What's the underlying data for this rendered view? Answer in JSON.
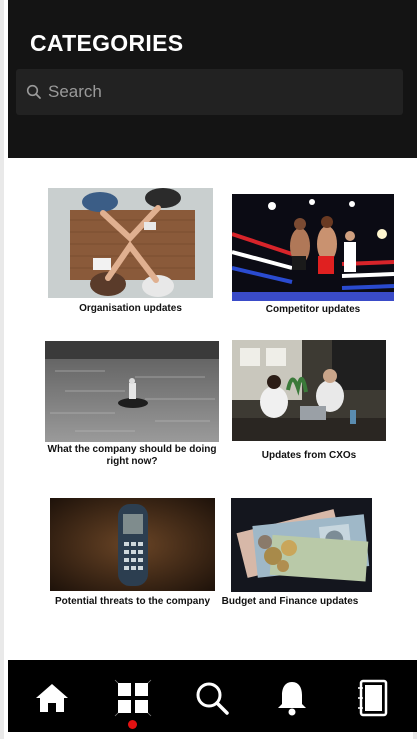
{
  "header": {
    "title": "CATEGORIES",
    "search_placeholder": "Search"
  },
  "categories": [
    {
      "label": "Organisation updates",
      "icon": "teamwork-hands-photo"
    },
    {
      "label": "Competitor updates",
      "icon": "boxing-ring-photo"
    },
    {
      "label": "What the company should be doing right now?",
      "icon": "boat-on-river-photo"
    },
    {
      "label": "Updates from CXOs",
      "icon": "office-meeting-photo"
    },
    {
      "label": "Potential threats to the company",
      "icon": "old-mobile-phone-photo"
    },
    {
      "label": "Budget and Finance updates",
      "icon": "banknotes-coins-photo"
    }
  ],
  "bottom_nav": {
    "items": [
      "home-icon",
      "categories-grid-icon",
      "search-icon",
      "bell-icon",
      "notebook-icon"
    ],
    "active": "categories-grid-icon",
    "active_dot_color": "#e21111"
  },
  "colors": {
    "header_bg": "#141414",
    "search_bg": "#222222",
    "nav_bg": "#000000"
  }
}
